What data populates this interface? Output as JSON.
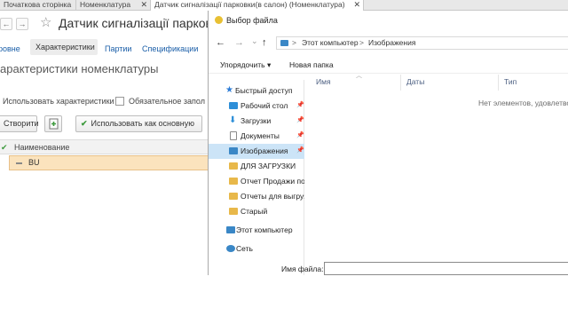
{
  "tabs": [
    {
      "label": "Початкова сторінка",
      "closable": false,
      "active": false
    },
    {
      "label": "Номенклатура",
      "closable": true,
      "active": false
    },
    {
      "label": "Датчик сигналізації парковки(в салон) (Номенклатура)",
      "closable": true,
      "active": true
    }
  ],
  "form": {
    "title": "Датчик сигналізації парковкі",
    "nav_back": "←",
    "nav_forward": "→",
    "subtabs": {
      "main": "ровне",
      "active": "Характеристики",
      "parties": "Партии",
      "spec": "Спецификации"
    },
    "section_title": "арактеристики номенклатуры",
    "use_characteristics_label": "Использовать характеристики",
    "required_label": "Обязательное запол",
    "create_button": "Створити",
    "use_main_button": "Использовать как основную",
    "grid": {
      "check_header": "✔",
      "column_header": "Наименование",
      "rows": [
        "BU"
      ]
    }
  },
  "dialog": {
    "title": "Выбор файла",
    "address": {
      "back": "←",
      "forward": "→",
      "dropdown": "⌄",
      "up": "↑",
      "path": [
        "Этот компьютер",
        "Изображения"
      ],
      "separator": ">"
    },
    "commands": {
      "organize": "Упорядочить ▾",
      "new_folder": "Новая папка"
    },
    "nav": [
      {
        "label": "Быстрый доступ",
        "icon": "star-icon",
        "pinned": false,
        "selected": false,
        "color": "#2b7bd6"
      },
      {
        "label": "Рабочий стол",
        "icon": "desktop-icon",
        "pinned": true,
        "selected": false,
        "color": "#2e8fd8"
      },
      {
        "label": "Загрузки",
        "icon": "download-icon",
        "pinned": true,
        "selected": false,
        "color": "#2e8fd8"
      },
      {
        "label": "Документы",
        "icon": "documents-icon",
        "pinned": true,
        "selected": false,
        "color": "#8a8a8a"
      },
      {
        "label": "Изображения",
        "icon": "pictures-icon",
        "pinned": true,
        "selected": true,
        "color": "#3a87c6"
      },
      {
        "label": "ДЛЯ ЗАГРУЗКИ",
        "icon": "folder-icon",
        "pinned": false,
        "selected": false,
        "color": "#e8b84a"
      },
      {
        "label": "Отчет Продажи по",
        "icon": "folder-icon",
        "pinned": false,
        "selected": false,
        "color": "#e8b84a"
      },
      {
        "label": "Отчеты для выгруз",
        "icon": "folder-icon",
        "pinned": false,
        "selected": false,
        "color": "#e8b84a"
      },
      {
        "label": "Старый",
        "icon": "folder-icon",
        "pinned": false,
        "selected": false,
        "color": "#e8b84a"
      },
      {
        "label": "Этот компьютер",
        "icon": "computer-icon",
        "pinned": false,
        "selected": false,
        "color": "#3a87c6"
      },
      {
        "label": "Сеть",
        "icon": "network-icon",
        "pinned": false,
        "selected": false,
        "color": "#3a87c6"
      }
    ],
    "columns": [
      "Имя",
      "Даты",
      "Тип"
    ],
    "empty_text": "Нет элементов, удовлетвор",
    "filename_label": "Имя файла:",
    "filename_value": ""
  },
  "colors": {
    "accent_link": "#1a5ea8",
    "selection_row": "#fbe3bd",
    "dialog_selection": "#cce4f7",
    "green_check": "#3d9a3d"
  }
}
